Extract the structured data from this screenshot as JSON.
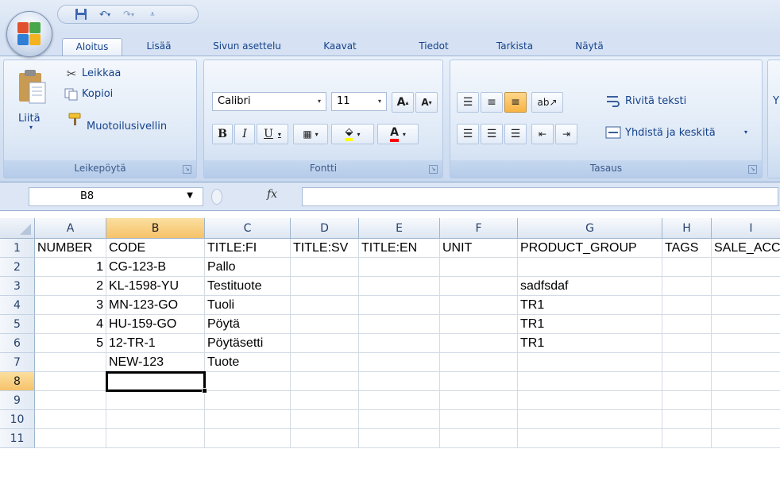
{
  "ribbon_tabs": [
    "Aloitus",
    "Lisää",
    "Sivun asettelu",
    "Kaavat",
    "Tiedot",
    "Tarkista",
    "Näytä"
  ],
  "active_tab": "Aloitus",
  "clipboard": {
    "paste_label": "Liitä",
    "cut_label": "Leikkaa",
    "copy_label": "Kopioi",
    "format_painter_label": "Muotoilusivellin",
    "group_label": "Leikepöytä"
  },
  "font": {
    "font_name": "Calibri",
    "font_size": "11",
    "bold": "B",
    "italic": "I",
    "underline": "U",
    "group_label": "Fontti"
  },
  "alignment": {
    "wrap_text_label": "Rivitä teksti",
    "merge_center_label": "Yhdistä ja keskitä",
    "group_label": "Tasaus",
    "next_group_partial": "Y"
  },
  "formula_bar": {
    "name_box": "B8",
    "fx": "fx",
    "formula": ""
  },
  "grid": {
    "column_headers": [
      "A",
      "B",
      "C",
      "D",
      "E",
      "F",
      "G",
      "H",
      "I"
    ],
    "row_headers": [
      "1",
      "2",
      "3",
      "4",
      "5",
      "6",
      "7",
      "8",
      "9",
      "10",
      "11"
    ],
    "selected_column": "B",
    "selected_row": "8",
    "rows": [
      [
        "NUMBER",
        "CODE",
        "TITLE:FI",
        "TITLE:SV",
        "TITLE:EN",
        "UNIT",
        "PRODUCT_GROUP",
        "TAGS",
        "SALE_ACC"
      ],
      [
        "1",
        "CG-123-B",
        "Pallo",
        "",
        "",
        "",
        "",
        "",
        ""
      ],
      [
        "2",
        "KL-1598-YU",
        "Testituote",
        "",
        "",
        "",
        "sadfsdaf",
        "",
        ""
      ],
      [
        "3",
        "MN-123-GO",
        "Tuoli",
        "",
        "",
        "",
        "TR1",
        "",
        ""
      ],
      [
        "4",
        "HU-159-GO",
        "Pöytä",
        "",
        "",
        "",
        "TR1",
        "",
        ""
      ],
      [
        "5",
        "12-TR-1",
        "Pöytäsetti",
        "",
        "",
        "",
        "TR1",
        "",
        ""
      ],
      [
        "",
        "NEW-123",
        "Tuote",
        "",
        "",
        "",
        "",
        "",
        ""
      ],
      [
        "",
        "",
        "",
        "",
        "",
        "",
        "",
        "",
        ""
      ],
      [
        "",
        "",
        "",
        "",
        "",
        "",
        "",
        "",
        ""
      ],
      [
        "",
        "",
        "",
        "",
        "",
        "",
        "",
        "",
        ""
      ],
      [
        "",
        "",
        "",
        "",
        "",
        "",
        "",
        "",
        ""
      ]
    ]
  },
  "colors": {
    "ribbon_blue": "#d6e2f3",
    "header_selected": "#f6c26a",
    "grid_line": "#d4dbe5"
  }
}
